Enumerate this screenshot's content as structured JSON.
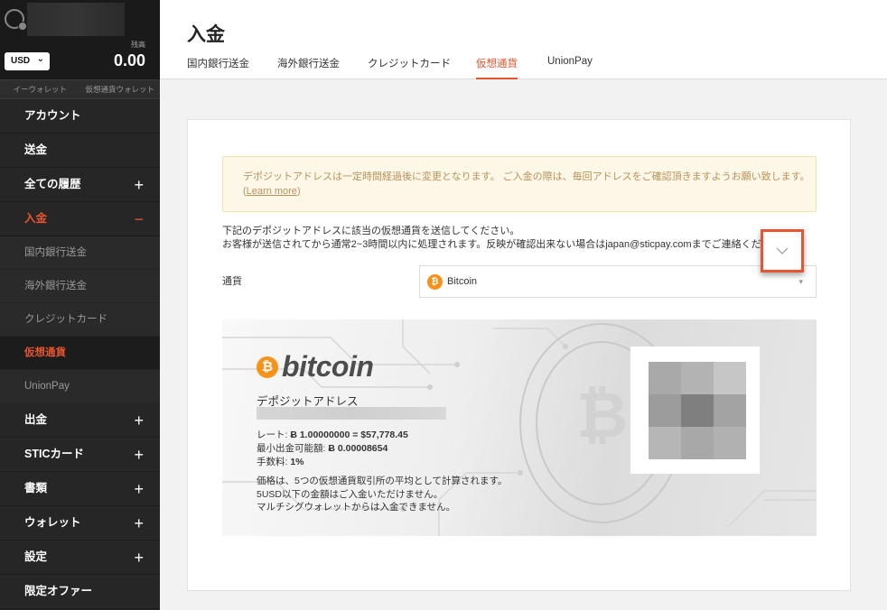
{
  "sidebar": {
    "currency": "USD",
    "balance_label": "残高",
    "balance": "0.00",
    "wallet_tabs": [
      "イーウォレット",
      "仮想通貨ウォレット"
    ],
    "menu": [
      {
        "label": "アカウント",
        "toggle": ""
      },
      {
        "label": "送金",
        "toggle": ""
      },
      {
        "label": "全ての履歴",
        "toggle": "+"
      },
      {
        "label": "入金",
        "toggle": "−"
      }
    ],
    "submenu": [
      "国内銀行送金",
      "海外銀行送金",
      "クレジットカード",
      "仮想通貨",
      "UnionPay"
    ],
    "menu_after": [
      {
        "label": "出金",
        "toggle": "+"
      },
      {
        "label": "STICカード",
        "toggle": "+"
      },
      {
        "label": "書類",
        "toggle": "+"
      },
      {
        "label": "ウォレット",
        "toggle": "+"
      },
      {
        "label": "設定",
        "toggle": "+"
      },
      {
        "label": "限定オファー",
        "toggle": ""
      }
    ]
  },
  "header": {
    "title": "入金",
    "tabs": [
      "国内銀行送金",
      "海外銀行送金",
      "クレジットカード",
      "仮想通貨",
      "UnionPay"
    ],
    "active_tab": "仮想通貨"
  },
  "notice": {
    "text": "デポジットアドレスは一定時間経過後に変更となります。 ご入金の際は、毎回アドレスをご確認頂きますようお願い致します。",
    "link_open": "(",
    "link": "Learn more",
    "link_close": ")"
  },
  "description": {
    "line1": "下記のデポジットアドレスに該当の仮想通貨を送信してください。",
    "line2": "お客様が送信されてから通常2~3時間以内に処理されます。反映が確認出来ない場合はjapan@sticpay.comまでご連絡くだ"
  },
  "form": {
    "currency_label": "通貨",
    "currency_value": "Bitcoin"
  },
  "bitcoin_panel": {
    "logo_symbol": "₿",
    "logo_text": "bitcoin",
    "address_label": "デポジットアドレス",
    "rate_label": "レート: ",
    "rate_value": "Ƀ 1.00000000 = $57,778.45",
    "min_label": "最小出金可能額: ",
    "min_value": "Ƀ 0.00008654",
    "fee_label": "手数料: ",
    "fee_value": "1%",
    "note1": "価格は、5つの仮想通貨取引所の平均として計算されます。",
    "note2": "5USD以下の金額はご入金いただけません。",
    "note3": "マルチシグウォレットからは入金できません。"
  },
  "colors": {
    "accent": "#e6552f",
    "bitcoin": "#f7931a",
    "sidebar_bg": "#262626"
  }
}
